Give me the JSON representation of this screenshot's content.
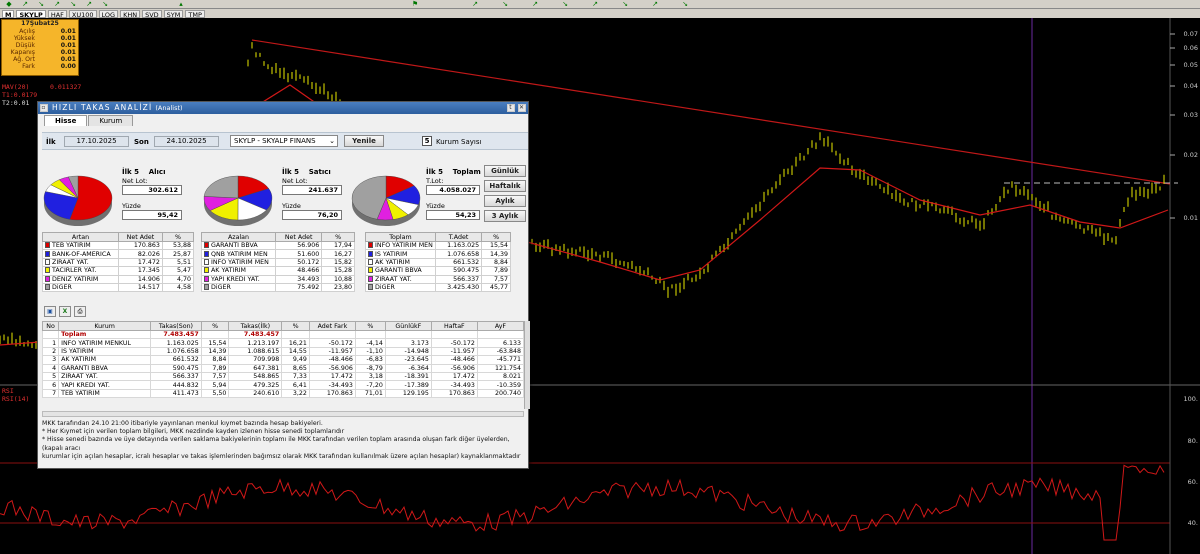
{
  "tabs": [
    "SKYLP",
    "HAF",
    "XU100",
    "LOG",
    "KHN",
    "SVD",
    "SYM",
    "TMP"
  ],
  "tab_prefix": "M",
  "info": {
    "title": "17Şubat25",
    "rows": [
      {
        "k": "Açılış",
        "v": "0.01"
      },
      {
        "k": "Yüksek",
        "v": "0.01"
      },
      {
        "k": "Düşük",
        "v": "0.01"
      },
      {
        "k": "Kapanış",
        "v": "0.01"
      },
      {
        "k": "Ağ. Ort",
        "v": "0.01"
      },
      {
        "k": "Fark",
        "v": "0.00"
      }
    ]
  },
  "indicators": {
    "mav": "MAV(20)",
    "mav_val": "0.011327",
    "t1": "T1:0.0179",
    "t2": "T2:0.01",
    "rsi": "RSI",
    "rsi14": "RSI(14)"
  },
  "price_axis": [
    "0.07",
    "0.06",
    "0.05",
    "0.04",
    "0.03",
    "0.02",
    "0.01"
  ],
  "rsi_axis": [
    "100.",
    "80.",
    "60.",
    "40."
  ],
  "colors": {
    "price": "#e8e800",
    "ma": "#d01818",
    "trend": "#c01818",
    "rsi": "#d01818",
    "title": "#2d5e9e"
  },
  "dialog": {
    "title": "HIZLI TAKAS ANALİZİ",
    "subtitle": "(Analist)",
    "tabs": [
      "Hisse",
      "Kurum"
    ],
    "ilk_label": "İlk",
    "ilk_date": "17.10.2025",
    "son_label": "Son",
    "son_date": "24.10.2025",
    "stock": "SKYLP - SKYALP FINANS",
    "refresh": "Yenile",
    "kurum_count": "5",
    "kurum_label": "Kurum Sayısı",
    "periods": [
      "Günlük",
      "Haftalık",
      "Aylık",
      "3 Aylık"
    ],
    "buyers": {
      "head1": "İlk 5",
      "head2": "Alıcı",
      "netlot_label": "Net Lot:",
      "netlot": "302.612",
      "pct_label": "Yüzde",
      "pct": "95,42"
    },
    "sellers": {
      "head1": "İlk 5",
      "head2": "Satıcı",
      "netlot_label": "Net Lot:",
      "netlot": "241.637",
      "pct_label": "Yüzde",
      "pct": "76,20"
    },
    "total": {
      "head1": "İlk 5",
      "head2": "Toplam",
      "netlot_label": "T.Lot:",
      "netlot": "4.058.027",
      "pct_label": "Yüzde",
      "pct": "54,23"
    },
    "artan": {
      "headers": [
        "Artan",
        "Net Adet",
        "%"
      ],
      "rows": [
        {
          "c": "#e00000",
          "name": "TEB YATIRIM",
          "adet": "170.863",
          "p": "53,88"
        },
        {
          "c": "#2020e0",
          "name": "BANK-OF-AMERICA",
          "adet": "82.026",
          "p": "25,87"
        },
        {
          "c": "#ffffff",
          "name": "ZIRAAT YAT.",
          "adet": "17.472",
          "p": "5,51"
        },
        {
          "c": "#f0f000",
          "name": "TACIRLER YAT.",
          "adet": "17.345",
          "p": "5,47"
        },
        {
          "c": "#e020e0",
          "name": "DENIZ YATIRIM",
          "adet": "14.906",
          "p": "4,70"
        },
        {
          "c": "#a0a0a0",
          "name": "DiGER",
          "adet": "14.517",
          "p": "4,58"
        }
      ]
    },
    "azalan": {
      "headers": [
        "Azalan",
        "Net Adet",
        "%"
      ],
      "rows": [
        {
          "c": "#e00000",
          "name": "GARANTI BBVA",
          "adet": "56.906",
          "p": "17,94"
        },
        {
          "c": "#2020e0",
          "name": "QNB YATIRIM MEN",
          "adet": "51.600",
          "p": "16,27"
        },
        {
          "c": "#ffffff",
          "name": "INFO YATIRIM MEN",
          "adet": "50.172",
          "p": "15,82"
        },
        {
          "c": "#f0f000",
          "name": "AK YATIRIM",
          "adet": "48.466",
          "p": "15,28"
        },
        {
          "c": "#e020e0",
          "name": "YAPI KREDI YAT.",
          "adet": "34.493",
          "p": "10,88"
        },
        {
          "c": "#a0a0a0",
          "name": "DiGER",
          "adet": "75.492",
          "p": "23,80"
        }
      ]
    },
    "toplam": {
      "headers": [
        "Toplam",
        "T.Adet",
        "%"
      ],
      "rows": [
        {
          "c": "#e00000",
          "name": "INFO YATIRIM MEN",
          "adet": "1.163.025",
          "p": "15,54"
        },
        {
          "c": "#2020e0",
          "name": "IS YATIRIM",
          "adet": "1.076.658",
          "p": "14,39"
        },
        {
          "c": "#ffffff",
          "name": "AK YATIRIM",
          "adet": "661.532",
          "p": "8,84"
        },
        {
          "c": "#f0f000",
          "name": "GARANTI BBVA",
          "adet": "590.475",
          "p": "7,89"
        },
        {
          "c": "#e020e0",
          "name": "ZIRAAT YAT.",
          "adet": "566.337",
          "p": "7,57"
        },
        {
          "c": "#a0a0a0",
          "name": "DiGER",
          "adet": "3.425.430",
          "p": "45,77"
        }
      ]
    },
    "bottom": {
      "headers": [
        "No",
        "Kurum",
        "Takas(Son)",
        "%",
        "Takas(İlk)",
        "%",
        "Adet Fark",
        "%",
        "GünlükF",
        "HaftaF",
        "AyF"
      ],
      "total": {
        "name": "Toplam",
        "son": "7.483.457",
        "ilk": "7.483.457"
      },
      "rows": [
        [
          "1",
          "INFO YATIRIM MENKUL",
          "1.163.025",
          "15,54",
          "1.213.197",
          "16,21",
          "-50.172",
          "-4,14",
          "3.173",
          "-50.172",
          "6.133"
        ],
        [
          "2",
          "IS YATIRIM",
          "1.076.658",
          "14,39",
          "1.088.615",
          "14,55",
          "-11.957",
          "-1,10",
          "-14.948",
          "-11.957",
          "-63.848"
        ],
        [
          "3",
          "AK YATIRIM",
          "661.532",
          "8,84",
          "709.998",
          "9,49",
          "-48.466",
          "-6,83",
          "-23.645",
          "-48.466",
          "-45.771"
        ],
        [
          "4",
          "GARANTI BBVA",
          "590.475",
          "7,89",
          "647.381",
          "8,65",
          "-56.906",
          "-8,79",
          "-6.364",
          "-56.906",
          "121.754"
        ],
        [
          "5",
          "ZIRAAT YAT.",
          "566.337",
          "7,57",
          "548.865",
          "7,33",
          "17.472",
          "3,18",
          "-18.391",
          "17.472",
          "8.021"
        ],
        [
          "6",
          "YAPI KREDI YAT.",
          "444.832",
          "5,94",
          "479.325",
          "6,41",
          "-34.493",
          "-7,20",
          "-17.389",
          "-34.493",
          "-10.359"
        ],
        [
          "7",
          "TEB YATIRIM",
          "411.473",
          "5,50",
          "240.610",
          "3,22",
          "170.863",
          "71,01",
          "129.195",
          "170.863",
          "200.740"
        ]
      ]
    },
    "notes": [
      "MKK tarafından 24.10 21:00 itibariyle yayınlanan menkul kıymet bazında hesap bakiyeleri.",
      "* Her Kıymet için verilen toplam bilgileri, MKK nezdinde kayden izlenen hisse senedi toplamlarıdır",
      "* Hisse senedi bazında ve üye detayında verilen saklama bakiyelerinin toplamı ile MKK tarafından verilen toplam arasında oluşan fark diğer üyelerden, (kapalı aracı",
      "kurumlar için açılan hesaplar, icralı hesaplar ve takas işlemlerinden bağımsız olarak MKK tarafından kullanılmak üzere açılan hesaplar) kaynaklanmaktadır"
    ]
  }
}
